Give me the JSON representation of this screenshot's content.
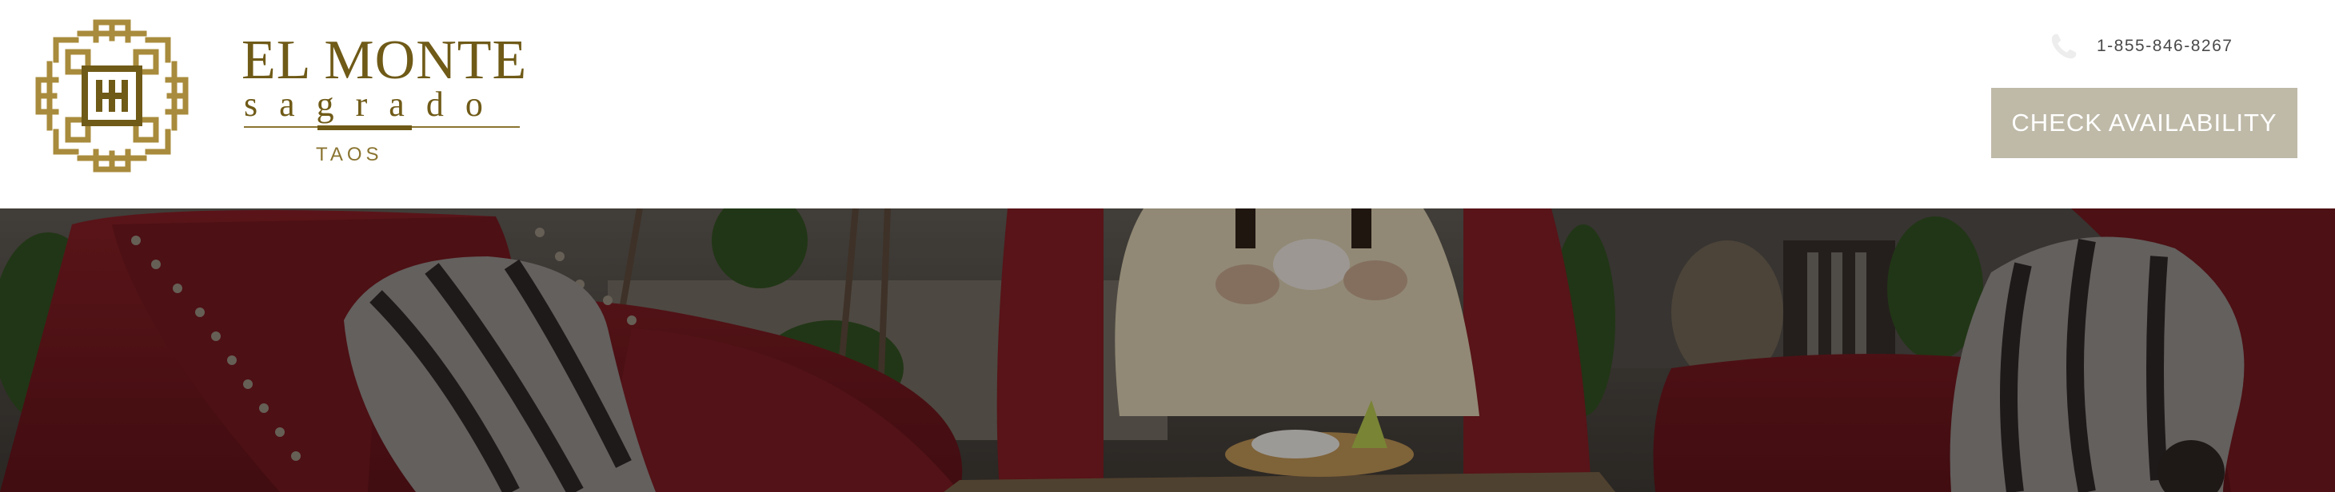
{
  "brand": {
    "line1": "EL MONTE",
    "line2": "SAGRADO",
    "city": "TAOS",
    "color": "#7a6418",
    "logo_icon": "geometric-knot-logo-icon"
  },
  "contact": {
    "phone": "1-855-846-8267",
    "icon": "phone-icon"
  },
  "cta": {
    "label": "CHECK AVAILABILITY",
    "bg_color": "#bfbaa8"
  },
  "hero": {
    "description_icon": "lounge-hero-image"
  }
}
